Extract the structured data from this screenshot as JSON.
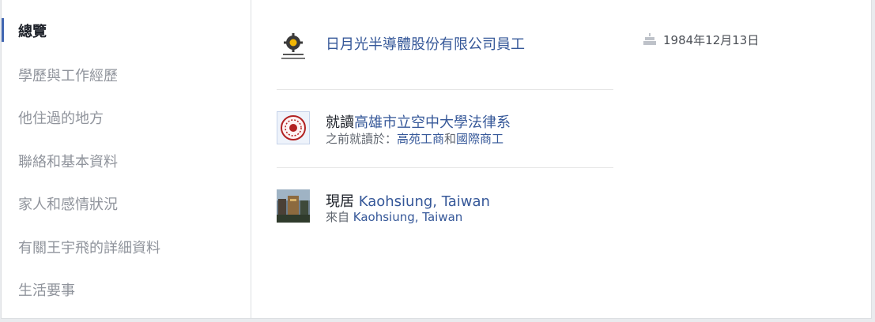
{
  "sidebar": {
    "items": [
      {
        "label": "總覽",
        "active": true
      },
      {
        "label": "學歷與工作經歷"
      },
      {
        "label": "他住過的地方"
      },
      {
        "label": "聯絡和基本資料"
      },
      {
        "label": "家人和感情狀況"
      },
      {
        "label": "有關王宇飛的詳細資料"
      },
      {
        "label": "生活要事"
      }
    ]
  },
  "overview": {
    "work": {
      "icon": "company-logo",
      "title": "日月光半導體股份有限公司員工"
    },
    "education": {
      "icon": "school-seal-logo",
      "prefix": "就讀",
      "school": "高雄市立空中大學法律系",
      "prev_prefix": "之前就讀於：",
      "prev_school_1": "高苑工商",
      "prev_and": "和",
      "prev_school_2": "國際商工"
    },
    "location": {
      "icon": "city-photo",
      "current_prefix": "現居",
      "current": "Kaohsiung, Taiwan",
      "from_prefix": "來自",
      "from": "Kaohsiung, Taiwan"
    },
    "birthday": {
      "icon": "cake-icon",
      "date": "1984年12月13日"
    }
  },
  "colors": {
    "accent": "#4267b2",
    "link": "#365899",
    "muted": "#90949c"
  }
}
